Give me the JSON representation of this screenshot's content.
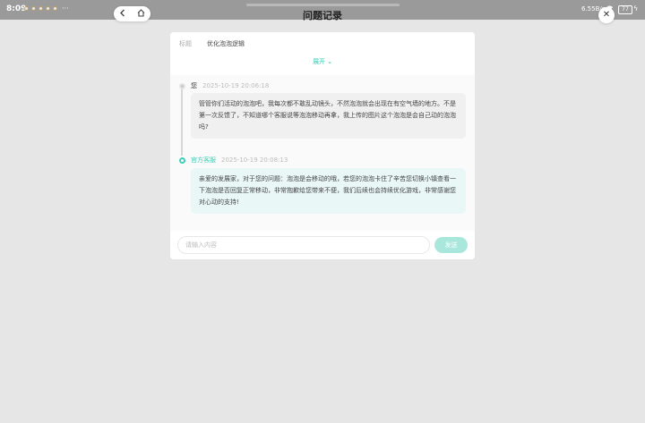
{
  "status_bar": {
    "time": "8:09",
    "more": "···",
    "network_speed": "6.55B/s",
    "battery": "77",
    "wifi_icon": "wifi-icon",
    "charging_icon": "bolt-icon"
  },
  "nav": {
    "back_icon": "chevron-left-icon",
    "home_icon": "home-icon"
  },
  "page": {
    "title": "问题记录",
    "close_icon": "close-icon"
  },
  "ticket": {
    "subject_label": "标题",
    "subject_value": "优化泡泡逻辑",
    "expand_label": "展开",
    "expand_icon": "chevron-down-icon"
  },
  "messages": [
    {
      "author": "您",
      "time": "2025-10-19 20:06:18",
      "text": "管管你们活动的泡泡吧，我每次都不敢乱动镜头，不然泡泡就会出现在有空气墙的地方。不是第一次反馈了，不知道哪个客服说等泡泡移动再拿，我上传的图片这个泡泡是会自己动的泡泡吗?"
    },
    {
      "author": "官方客服",
      "time": "2025-10-19 20:08:13",
      "text": "亲爱的发展家，对于您的问题：泡泡是会移动的哦，若您的泡泡卡住了辛苦您切换小镇查看一下泡泡是否回复正常移动，非常抱歉给您带来不便，我们后续也会持续优化游戏，非常感谢您对心动的支持!"
    }
  ],
  "composer": {
    "placeholder": "请输入内容",
    "send_label": "发送"
  },
  "colors": {
    "accent": "#3ccfb9",
    "send_button": "#a9e7dc",
    "background": "#e6e6e6"
  }
}
